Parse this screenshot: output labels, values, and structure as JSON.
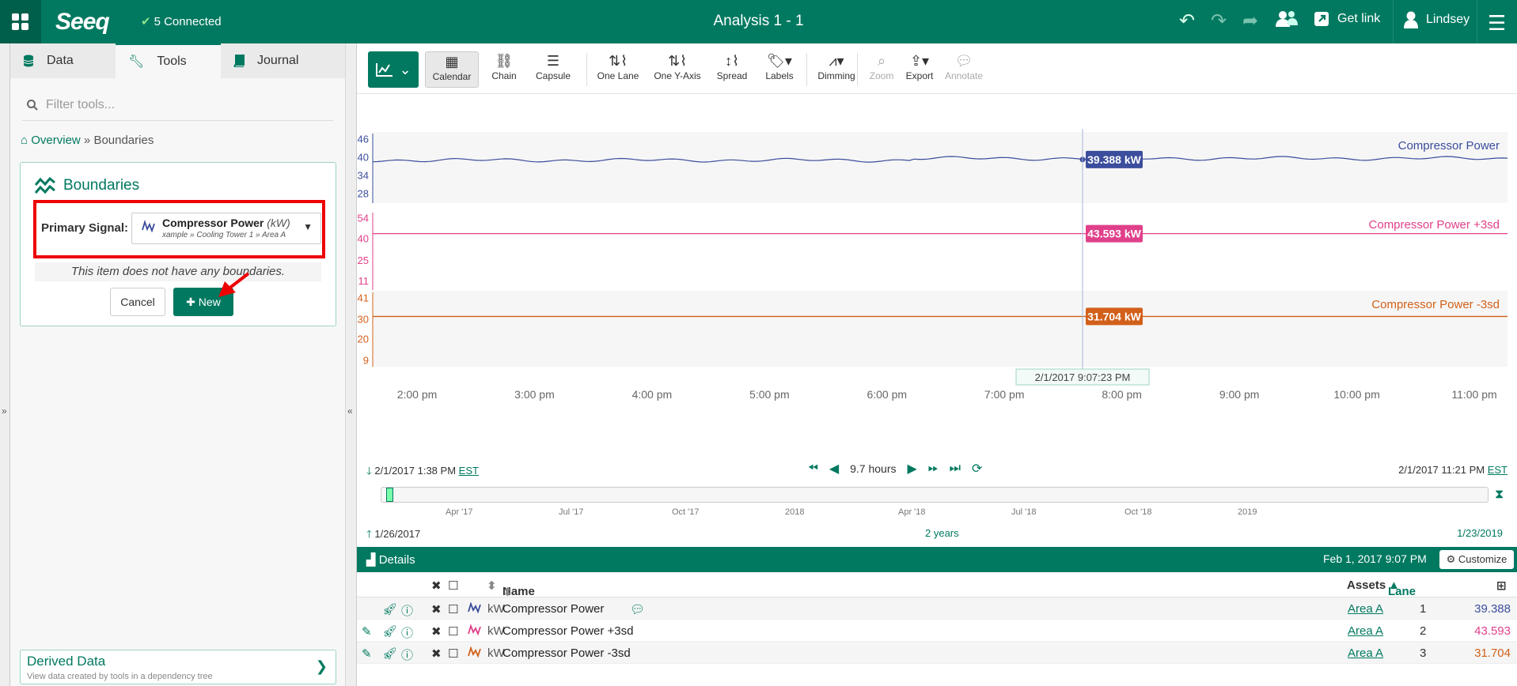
{
  "topbar": {
    "logo": "Seeq",
    "connection_status": "5 Connected",
    "title": "Analysis 1 - 1",
    "get_link_label": "Get link",
    "user_name": "Lindsey"
  },
  "left_panel": {
    "tabs": [
      {
        "label": "Data",
        "icon": "database-icon"
      },
      {
        "label": "Tools",
        "icon": "wrench-icon"
      },
      {
        "label": "Journal",
        "icon": "book-icon"
      }
    ],
    "filter_placeholder": "Filter tools...",
    "breadcrumb": {
      "home": "Overview",
      "sep": "»",
      "current": "Boundaries"
    },
    "tool": {
      "title": "Boundaries",
      "primary_signal_label": "Primary Signal:",
      "signal_name": "Compressor Power",
      "signal_unit": "(kW)",
      "signal_path": "xample » Cooling Tower 1 » Area A",
      "empty_message": "This item does not have any boundaries.",
      "cancel_label": "Cancel",
      "new_label": "New"
    },
    "derived_data": {
      "title": "Derived Data",
      "subtitle": "View data created by tools in a dependency tree"
    }
  },
  "toolbar": {
    "buttons": [
      {
        "label": "Calendar",
        "icon": "calendar-icon"
      },
      {
        "label": "Chain",
        "icon": "chain-icon"
      },
      {
        "label": "Capsule",
        "icon": "capsule-icon"
      },
      {
        "label": "One Lane",
        "icon": "one-lane-icon"
      },
      {
        "label": "One Y-Axis",
        "icon": "one-y-axis-icon"
      },
      {
        "label": "Spread",
        "icon": "spread-icon"
      },
      {
        "label": "Labels",
        "icon": "tag-icon"
      },
      {
        "label": "Dimming",
        "icon": "dimming-icon"
      },
      {
        "label": "Zoom",
        "icon": "zoom-icon"
      },
      {
        "label": "Export",
        "icon": "export-icon"
      },
      {
        "label": "Annotate",
        "icon": "comment-icon"
      }
    ]
  },
  "chart_data": {
    "type": "line",
    "x_ticks": [
      "2:00 pm",
      "3:00 pm",
      "4:00 pm",
      "5:00 pm",
      "6:00 pm",
      "7:00 pm",
      "8:00 pm",
      "9:00 pm",
      "10:00 pm",
      "11:00 pm"
    ],
    "cursor_label": "2/1/2017 9:07:23 PM",
    "lanes": [
      {
        "name": "Compressor Power",
        "color": "#3b4d9c",
        "y_ticks": [
          46,
          40,
          34,
          28
        ],
        "ylim": [
          25,
          48
        ],
        "cursor_value": "39.388 kW",
        "approx_level": 39.4
      },
      {
        "name": "Compressor Power +3sd",
        "color": "#e0408a",
        "y_ticks": [
          54,
          40,
          25,
          11
        ],
        "ylim": [
          5,
          58
        ],
        "cursor_value": "43.593 kW",
        "approx_level": 43.593
      },
      {
        "name": "Compressor Power -3sd",
        "color": "#d2601a",
        "y_ticks": [
          41,
          30,
          20,
          9
        ],
        "ylim": [
          6,
          44
        ],
        "cursor_value": "31.704 kW",
        "approx_level": 31.704
      }
    ]
  },
  "time_nav": {
    "start": "2/1/2017 1:38 PM",
    "end": "2/1/2017 11:21 PM",
    "tz": "EST",
    "duration": "9.7 hours"
  },
  "overview": {
    "months": [
      "Apr '17",
      "Jul '17",
      "Oct '17",
      "2018",
      "Apr '18",
      "Jul '18",
      "Oct '18",
      "2019"
    ],
    "start": "1/26/2017",
    "duration": "2 years",
    "end": "1/23/2019"
  },
  "details": {
    "title": "Details",
    "date": "Feb 1, 2017 9:07 PM",
    "customize_label": "Customize",
    "columns": {
      "name": "Name",
      "assets": "Assets",
      "lane": "Lane"
    },
    "rows": [
      {
        "unit": "kW",
        "name": "Compressor Power",
        "asset": "Area A",
        "lane": "1",
        "value": "39.388",
        "color": "#3b4d9c"
      },
      {
        "unit": "kW",
        "name": "Compressor Power +3sd",
        "asset": "Area A",
        "lane": "2",
        "value": "43.593",
        "color": "#e0408a"
      },
      {
        "unit": "kW",
        "name": "Compressor Power -3sd",
        "asset": "Area A",
        "lane": "3",
        "value": "31.704",
        "color": "#d2601a"
      }
    ]
  }
}
